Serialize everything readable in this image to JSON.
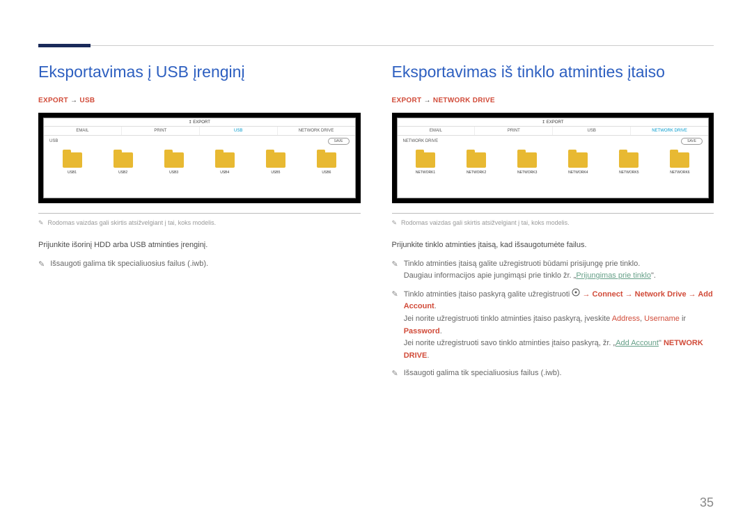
{
  "left": {
    "heading": "Eksportavimas į USB įrenginį",
    "path_pre": "EXPORT",
    "path_arrow": "→",
    "path_post": "USB",
    "ss": {
      "export_label": "↥ EXPORT",
      "tabs": [
        "EMAIL",
        "PRINT",
        "USB",
        "NETWORK DRIVE"
      ],
      "active_idx": 2,
      "loc": "USB",
      "save": "SAVE",
      "folders": [
        "USB1",
        "USB2",
        "USB3",
        "USB4",
        "USB5",
        "USB6"
      ]
    },
    "disclaimer": "Rodomas vaizdas gali skirtis atsižvelgiant į tai, koks modelis.",
    "intro": "Prijunkite išorinį HDD arba USB atminties įrenginį.",
    "bullet1": "Išsaugoti galima tik specialiuosius failus (.iwb)."
  },
  "right": {
    "heading": "Eksportavimas iš tinklo atminties įtaiso",
    "path_pre": "EXPORT",
    "path_arrow": "→",
    "path_post": "NETWORK DRIVE",
    "ss": {
      "export_label": "↥ EXPORT",
      "tabs": [
        "EMAIL",
        "PRINT",
        "USB",
        "NETWORK DRIVE"
      ],
      "active_idx": 3,
      "loc": "NETWORK DRIVE",
      "save": "SAVE",
      "folders": [
        "NETWORK1",
        "NETWORK2",
        "NETWORK3",
        "NETWORK4",
        "NETWORK5",
        "NETWORK6"
      ]
    },
    "disclaimer": "Rodomas vaizdas gali skirtis atsižvelgiant į tai, koks modelis.",
    "intro": "Prijunkite tinklo atminties įtaisą, kad išsaugotumėte failus.",
    "b1a": "Tinklo atminties įtaisą galite užregistruoti būdami prisijungę prie tinklo.",
    "b1b_pre": "Daugiau informacijos apie jungimąsi prie tinklo žr. „",
    "b1b_link": "Prijungimas prie tinklo",
    "b1b_post": "\".",
    "b2a_pre": "Tinklo atminties įtaiso paskyrą galite užregistruoti ",
    "b2a_path": " → Connect → Network Drive → Add Account",
    "b2a_end": ".",
    "b2b_pre": "Jei norite užregistruoti tinklo atminties įtaiso paskyrą, įveskite ",
    "b2b_addr": "Address",
    "b2b_sep1": ", ",
    "b2b_user": "Username",
    "b2b_sep2": " ir ",
    "b2b_pass": "Password",
    "b2b_end": ".",
    "b2c_pre": "Jei norite užregistruoti savo tinklo atminties įtaiso paskyrą, žr. „",
    "b2c_link": "Add Account",
    "b2c_mid": "\" ",
    "b2c_nd": "NETWORK DRIVE",
    "b2c_end": ".",
    "b3": "Išsaugoti galima tik specialiuosius failus (.iwb)."
  },
  "page_number": "35"
}
